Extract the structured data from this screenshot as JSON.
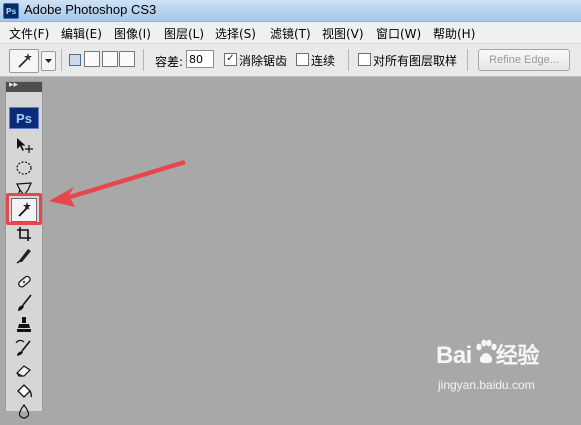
{
  "window": {
    "title": "Adobe Photoshop CS3",
    "app_icon_text": "Ps"
  },
  "menu": {
    "items": [
      "文件(F)",
      "编辑(E)",
      "图像(I)",
      "图层(L)",
      "选择(S)",
      "滤镜(T)",
      "视图(V)",
      "窗口(W)",
      "帮助(H)"
    ]
  },
  "options_bar": {
    "tool_preset_icon": "magic-wand-icon",
    "tolerance_label": "容差:",
    "tolerance_value": "80",
    "antialias_label": "消除锯齿",
    "antialias_checked": true,
    "antialias_mark": "✓",
    "contiguous_label": "连续",
    "contiguous_checked": false,
    "sample_all_layers_label": "对所有图层取样",
    "sample_all_layers_checked": false,
    "refine_edge_label": "Refine Edge..."
  },
  "toolbox": {
    "grip_glyph": "▸▸",
    "logo_text": "Ps",
    "tools": [
      "move-tool-icon",
      "elliptical-marquee-icon",
      "lasso-icon",
      "magic-wand-icon",
      "crop-icon",
      "slice-icon",
      "healing-brush-icon",
      "brush-icon",
      "clone-stamp-icon",
      "history-brush-icon",
      "eraser-icon",
      "paint-bucket-icon",
      "blur-icon"
    ],
    "selected_tool": "magic-wand-icon"
  },
  "annotation": {
    "color": "#e7474b"
  },
  "watermark": {
    "main": "Bai",
    "main_suffix": "经验",
    "sub": "jingyan.baidu.com"
  },
  "colors": {
    "workspace": "#a8a8a8",
    "annotation_red": "#e7474b"
  }
}
